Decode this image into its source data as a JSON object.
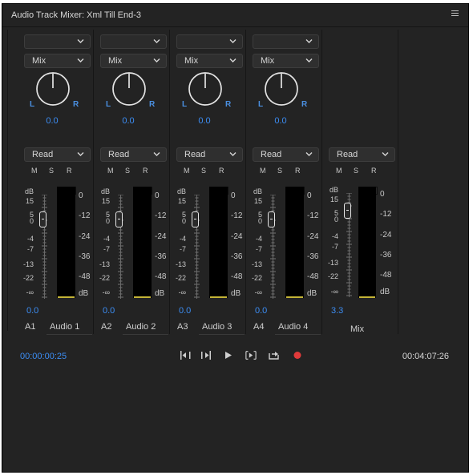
{
  "panel": {
    "title": "Audio Track Mixer: Xml Till End-3"
  },
  "channels": [
    {
      "id": "A1",
      "name": "Audio 1",
      "mode": "Mix",
      "automation": "Read",
      "pan_l": "L",
      "pan_r": "R",
      "pan_value": "0.0",
      "volume": "0.0",
      "m": "M",
      "s": "S",
      "r": "R"
    },
    {
      "id": "A2",
      "name": "Audio 2",
      "mode": "Mix",
      "automation": "Read",
      "pan_l": "L",
      "pan_r": "R",
      "pan_value": "0.0",
      "volume": "0.0",
      "m": "M",
      "s": "S",
      "r": "R"
    },
    {
      "id": "A3",
      "name": "Audio 3",
      "mode": "Mix",
      "automation": "Read",
      "pan_l": "L",
      "pan_r": "R",
      "pan_value": "0.0",
      "volume": "0.0",
      "m": "M",
      "s": "S",
      "r": "R"
    },
    {
      "id": "A4",
      "name": "Audio 4",
      "mode": "Mix",
      "automation": "Read",
      "pan_l": "L",
      "pan_r": "R",
      "pan_value": "0.0",
      "volume": "0.0",
      "m": "M",
      "s": "S",
      "r": "R"
    }
  ],
  "master": {
    "name": "Mix",
    "automation": "Read",
    "volume": "3.3",
    "m": "M",
    "s": "S",
    "r": "R"
  },
  "scale_left": [
    "dB",
    "15",
    "5",
    "0",
    "-4",
    "-7",
    "-13",
    "-22",
    "-∞"
  ],
  "scale_right": [
    "0",
    "-12",
    "-24",
    "-36",
    "-48",
    "dB"
  ],
  "transport": {
    "timecode_current": "00:00:00:25",
    "timecode_end": "00:04:07:26",
    "buttons": [
      "go-to-in-point-icon",
      "go-to-out-point-icon",
      "play-icon",
      "play-in-to-out-icon",
      "loop-icon",
      "record-icon"
    ]
  },
  "colors": {
    "accent_blue": "#3c8df3",
    "record_red": "#e03a3a",
    "meter_floor": "#c4b436"
  }
}
